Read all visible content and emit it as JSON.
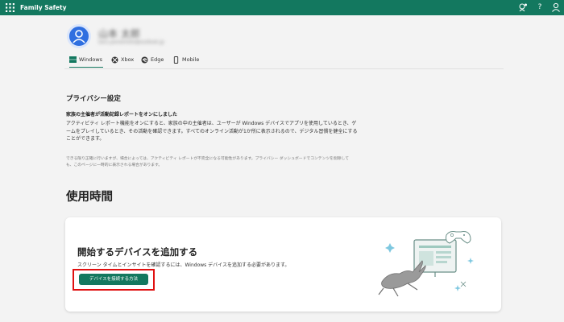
{
  "topbar": {
    "title": "Family Safety",
    "bg_color": "#13785f",
    "icons": [
      "waffle-icon",
      "feedback-icon",
      "help-icon",
      "account-icon"
    ],
    "help_glyph": "?"
  },
  "profile": {
    "name": "山本 太郎",
    "email": "taro.yamamoto@outlook.jp",
    "avatar_color": "#2f6fe0"
  },
  "tabs": [
    {
      "label": "Windows",
      "icon": "windows-icon",
      "active": true
    },
    {
      "label": "Xbox",
      "icon": "xbox-icon",
      "active": false
    },
    {
      "label": "Edge",
      "icon": "edge-icon",
      "active": false
    },
    {
      "label": "Mobile",
      "icon": "mobile-icon",
      "active": false
    }
  ],
  "privacy": {
    "heading": "プライバシー設定",
    "subheading": "家族の主催者が活動記録レポートをオンにしました",
    "description": "アクティビティ レポート機能をオンにすると、家族の中の主催者は、ユーザーが Windows デバイスでアプリを使用しているとき、ゲームをプレイしているとき、その活動を確認できます。すべてのオンライン活動が1か所に表示されるので、デジタル習慣を健全にすることができます。",
    "note": "できる限り正確に行いますが、場合によっては、アクティビティ レポートが不完全になる可能性があります。プライバシー ダッシュボードでコンテンツを削除しても、このページに一時的に表示される場合があります。"
  },
  "usage": {
    "heading": "使用時間",
    "card": {
      "title": "開始するデバイスを追加する",
      "description": "スクリーン タイムとインサイトを確認するには、Windows デバイスを追加する必要があります。",
      "button_label": "デバイスを接続する方法",
      "button_color": "#13785f",
      "highlight_color": "#e01010"
    }
  }
}
